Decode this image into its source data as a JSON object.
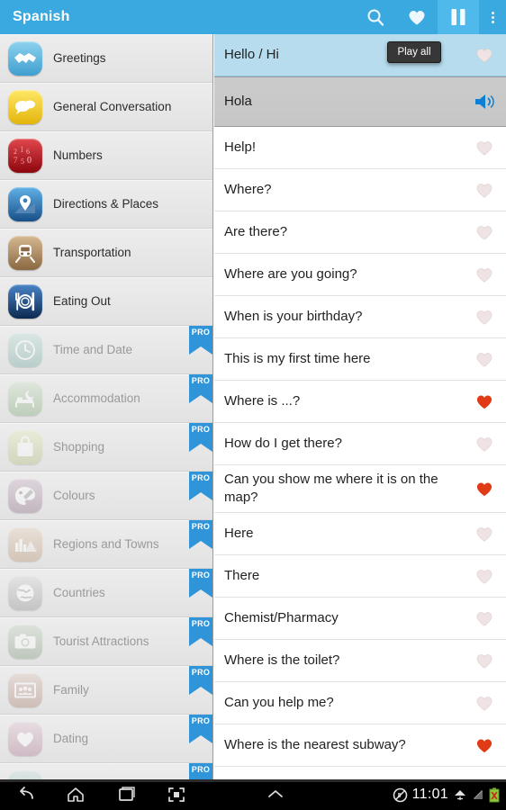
{
  "header": {
    "title": "Spanish",
    "icons": [
      {
        "name": "search-icon",
        "label": "Search"
      },
      {
        "name": "favorites-heart-icon",
        "label": "Favorites"
      },
      {
        "name": "pause-icon",
        "label": "Pause",
        "active": true
      },
      {
        "name": "overflow-menu-icon",
        "label": "More options"
      }
    ]
  },
  "tooltip": {
    "text": "Play all"
  },
  "sidebar": {
    "items": [
      {
        "label": "Greetings",
        "icon": "handshake-icon",
        "pro": false,
        "color1": "#7fc9e8",
        "color2": "#3f9fd0"
      },
      {
        "label": "General Conversation",
        "icon": "speech-bubbles-icon",
        "pro": false,
        "color1": "#ffe14a",
        "color2": "#e8bb0d"
      },
      {
        "label": "Numbers",
        "icon": "numbers-icon",
        "pro": false,
        "color1": "#d6333a",
        "color2": "#96080f"
      },
      {
        "label": "Directions & Places",
        "icon": "map-pin-icon",
        "pro": false,
        "color1": "#4da2dd",
        "color2": "#1a5f9e"
      },
      {
        "label": "Transportation",
        "icon": "train-icon",
        "pro": false,
        "color1": "#c8a87e",
        "color2": "#8e6c42"
      },
      {
        "label": "Eating Out",
        "icon": "cutlery-plate-icon",
        "pro": false,
        "color1": "#3a74b8",
        "color2": "#0d2b58"
      },
      {
        "label": "Time and Date",
        "icon": "clock-icon",
        "pro": true,
        "color1": "#8fe0d4",
        "color2": "#4fbfae"
      },
      {
        "label": "Accommodation",
        "icon": "bed-moon-icon",
        "pro": true,
        "color1": "#a9df9e",
        "color2": "#6cbf5c"
      },
      {
        "label": "Shopping",
        "icon": "shopping-bag-icon",
        "pro": true,
        "color1": "#dbe87f",
        "color2": "#bacb45"
      },
      {
        "label": "Colours",
        "icon": "palette-icon",
        "pro": true,
        "color1": "#d39fc6",
        "color2": "#b06fa0"
      },
      {
        "label": "Regions and Towns",
        "icon": "landscape-icon",
        "pro": true,
        "color1": "#f3c08a",
        "color2": "#e0954c"
      },
      {
        "label": "Countries",
        "icon": "globe-icon",
        "pro": true,
        "color1": "#c9c9c9",
        "color2": "#9a9a9a"
      },
      {
        "label": "Tourist Attractions",
        "icon": "camera-icon",
        "pro": true,
        "color1": "#a9cfa2",
        "color2": "#74ab6a"
      },
      {
        "label": "Family",
        "icon": "family-photo-icon",
        "pro": true,
        "color1": "#eda892",
        "color2": "#d87f63"
      },
      {
        "label": "Dating",
        "icon": "heart-icon",
        "pro": true,
        "color1": "#f2a8cd",
        "color2": "#e274ab"
      },
      {
        "label": "",
        "icon": "partial-icon",
        "pro": true,
        "color1": "#9adfd3",
        "color2": "#5cc0b0"
      }
    ]
  },
  "list": {
    "rows": [
      {
        "text": "Hello / Hi",
        "type": "phrase",
        "selected": true,
        "favorite": false
      },
      {
        "text": "Hola",
        "type": "translation",
        "selected": false,
        "favorite": false,
        "action": "speaker-icon"
      },
      {
        "text": "Help!",
        "type": "phrase",
        "selected": false,
        "favorite": false
      },
      {
        "text": "Where?",
        "type": "phrase",
        "selected": false,
        "favorite": false
      },
      {
        "text": "Are there?",
        "type": "phrase",
        "selected": false,
        "favorite": false
      },
      {
        "text": "Where are you going?",
        "type": "phrase",
        "selected": false,
        "favorite": false
      },
      {
        "text": "When is your birthday?",
        "type": "phrase",
        "selected": false,
        "favorite": false
      },
      {
        "text": "This is my first time here",
        "type": "phrase",
        "selected": false,
        "favorite": false
      },
      {
        "text": "Where is ...?",
        "type": "phrase",
        "selected": false,
        "favorite": true
      },
      {
        "text": "How do I get there?",
        "type": "phrase",
        "selected": false,
        "favorite": false
      },
      {
        "text": "Can you show me where it is on the map?",
        "type": "phrase",
        "selected": false,
        "favorite": true
      },
      {
        "text": "Here",
        "type": "phrase",
        "selected": false,
        "favorite": false
      },
      {
        "text": "There",
        "type": "phrase",
        "selected": false,
        "favorite": false
      },
      {
        "text": "Chemist/Pharmacy",
        "type": "phrase",
        "selected": false,
        "favorite": false
      },
      {
        "text": "Where is the toilet?",
        "type": "phrase",
        "selected": false,
        "favorite": false
      },
      {
        "text": "Can you help me?",
        "type": "phrase",
        "selected": false,
        "favorite": false
      },
      {
        "text": "Where is the nearest subway?",
        "type": "phrase",
        "selected": false,
        "favorite": true
      },
      {
        "text": "",
        "type": "phrase",
        "selected": false,
        "favorite": false
      }
    ]
  },
  "navbar": {
    "buttons": [
      {
        "name": "back-button",
        "label": "Back"
      },
      {
        "name": "home-button",
        "label": "Home"
      },
      {
        "name": "recents-button",
        "label": "Recent apps"
      },
      {
        "name": "screenshot-button",
        "label": "Screenshot"
      },
      {
        "name": "expand-button",
        "label": "Expand"
      }
    ],
    "status": {
      "mute_icon": "mute-icon",
      "time": "11:01",
      "wifi_icon": "wifi-icon",
      "signal_icon": "signal-icon",
      "battery_icon": "battery-error-icon"
    }
  },
  "colors": {
    "accent": "#3aa9e0",
    "selected_row": "#b6dced",
    "translation_row": "#c8c8c8",
    "favorite_heart": "#e03b16",
    "empty_heart": "#e3d8d8",
    "pro_badge": "#2f94d8"
  }
}
